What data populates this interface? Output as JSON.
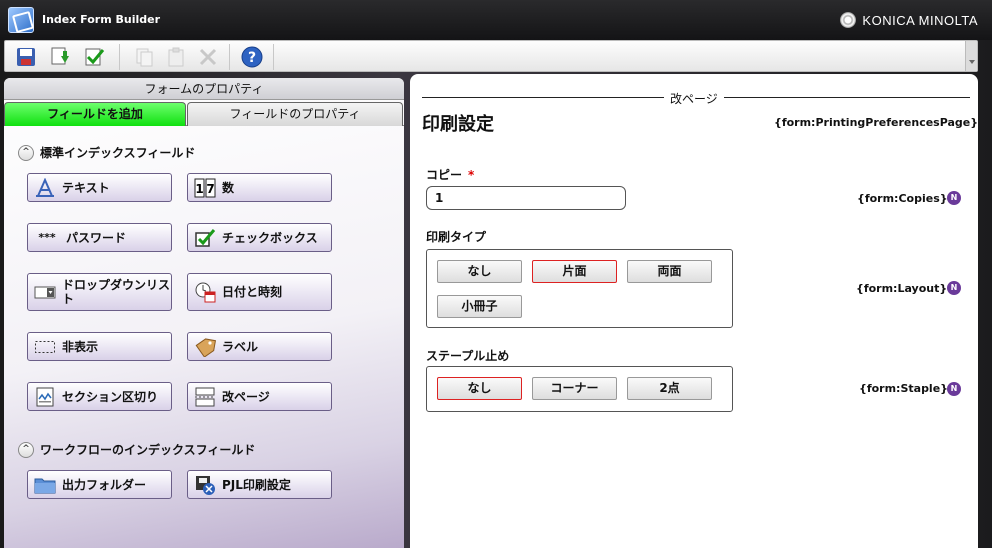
{
  "window": {
    "title": "Index Form Builder",
    "brand": "KONICA MINOLTA"
  },
  "toolbar": {
    "buttons": [
      {
        "name": "save",
        "icon": "save-icon"
      },
      {
        "name": "save-as",
        "icon": "download-icon"
      },
      {
        "name": "validate",
        "icon": "checkmark-icon"
      },
      {
        "name": "copy",
        "icon": "copy-icon"
      },
      {
        "name": "paste",
        "icon": "paste-icon"
      },
      {
        "name": "delete",
        "icon": "close-icon"
      },
      {
        "name": "help",
        "icon": "help-icon"
      }
    ]
  },
  "left_panel": {
    "header": "フォームのプロパティ",
    "tabs": [
      {
        "label": "フィールドを追加",
        "active": true
      },
      {
        "label": "フィールドのプロパティ",
        "active": false
      }
    ],
    "standard_section": {
      "title": "標準インデックスフィールド"
    },
    "standard_fields": {
      "text": "テキスト",
      "number": "数",
      "password": "パスワード",
      "password_icon": "***",
      "checkbox": "チェックボックス",
      "dropdown": "ドロップダウンリスト",
      "datetime": "日付と時刻",
      "hidden": "非表示",
      "label": "ラベル",
      "section_break": "セクション区切り",
      "page_break": "改ページ"
    },
    "workflow_section": {
      "title": "ワークフローのインデックスフィールド"
    },
    "workflow_fields": {
      "output_folder": "出力フォルダー",
      "pjl_print": "PJL印刷設定"
    }
  },
  "form": {
    "page_break_label": "改ページ",
    "title": "印刷設定",
    "title_tag": "{form:PrintingPreferencesPage}",
    "copies": {
      "label": "コピー",
      "required_mark": "*",
      "value": "1",
      "tag": "{form:Copies}"
    },
    "layout": {
      "label": "印刷タイプ",
      "tag": "{form:Layout}",
      "options": [
        "なし",
        "片面",
        "両面",
        "小冊子"
      ],
      "selected": "片面"
    },
    "staple": {
      "label": "ステープル止め",
      "tag": "{form:Staple}",
      "options": [
        "なし",
        "コーナー",
        "2点"
      ],
      "selected": "なし"
    },
    "badge": "N"
  }
}
